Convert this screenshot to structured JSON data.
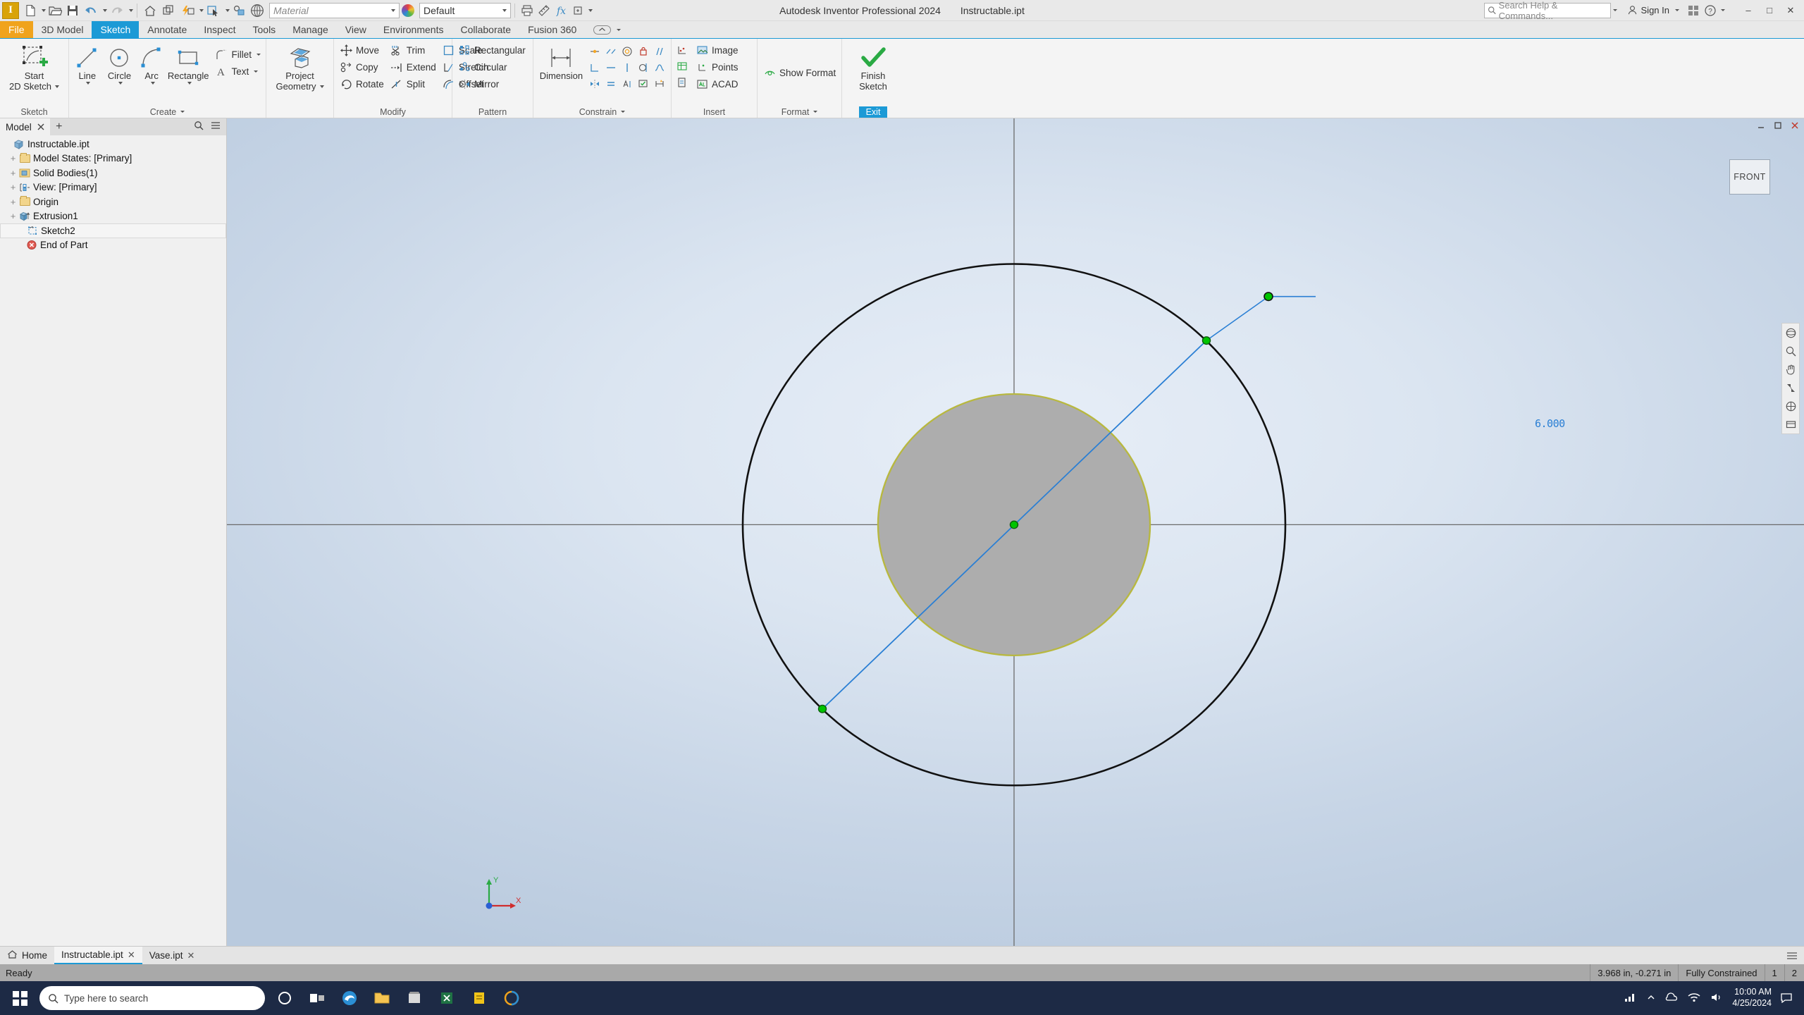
{
  "titlebar": {
    "app_title": "Autodesk Inventor Professional 2024",
    "document_title": "Instructable.ipt",
    "material_value": "Material",
    "appearance_value": "Default",
    "search_placeholder": "Search Help & Commands...",
    "signin_label": "Sign In",
    "minimize": "–",
    "maximize": "□",
    "close": "✕",
    "help_label": "?"
  },
  "ribbon_tabs": {
    "file": "File",
    "items": [
      "3D Model",
      "Sketch",
      "Annotate",
      "Inspect",
      "Tools",
      "Manage",
      "View",
      "Environments",
      "Collaborate",
      "Fusion 360"
    ],
    "active": "Sketch"
  },
  "ribbon": {
    "panels": [
      {
        "title": "Sketch",
        "buttons": [
          {
            "label_line1": "Start",
            "label_line2": "2D Sketch",
            "icon": "start-2d-sketch-icon"
          }
        ]
      },
      {
        "title": "Create",
        "buttons": [
          {
            "label_line1": "Line",
            "icon": "line-icon"
          },
          {
            "label_line1": "Circle",
            "icon": "circle-icon"
          },
          {
            "label_line1": "Arc",
            "icon": "arc-icon"
          },
          {
            "label_line1": "Rectangle",
            "icon": "rectangle-icon"
          }
        ],
        "small_items": [
          {
            "label": "Fillet",
            "icon": "fillet-icon"
          },
          {
            "label": "Text",
            "icon": "text-icon"
          }
        ]
      },
      {
        "title": "",
        "buttons": [
          {
            "label_line1": "Project",
            "label_line2": "Geometry",
            "icon": "project-geometry-icon"
          }
        ]
      },
      {
        "title": "Modify",
        "columns": [
          [
            {
              "label": "Move",
              "icon": "move-icon"
            },
            {
              "label": "Copy",
              "icon": "copy-icon"
            },
            {
              "label": "Rotate",
              "icon": "rotate-icon"
            }
          ],
          [
            {
              "label": "Trim",
              "icon": "trim-icon"
            },
            {
              "label": "Extend",
              "icon": "extend-icon"
            },
            {
              "label": "Split",
              "icon": "split-icon"
            }
          ],
          [
            {
              "label": "Scale",
              "icon": "scale-icon"
            },
            {
              "label": "Stretch",
              "icon": "stretch-icon"
            },
            {
              "label": "Offset",
              "icon": "offset-icon"
            }
          ]
        ]
      },
      {
        "title": "Pattern",
        "columns": [
          [
            {
              "label": "Rectangular",
              "icon": "rectangular-pattern-icon"
            },
            {
              "label": "Circular",
              "icon": "circular-pattern-icon"
            },
            {
              "label": "Mirror",
              "icon": "mirror-icon"
            }
          ]
        ]
      },
      {
        "title": "Constrain",
        "buttons": [
          {
            "label_line1": "Dimension",
            "icon": "dimension-icon"
          }
        ],
        "icon_grid": [
          "coincident-constraint-icon",
          "collinear-constraint-icon",
          "concentric-constraint-icon",
          "fix-constraint-icon",
          "parallel-constraint-icon",
          "perpendicular-constraint-icon",
          "horizontal-constraint-icon",
          "vertical-constraint-icon",
          "tangent-constraint-icon",
          "smooth-constraint-icon",
          "symmetric-constraint-icon",
          "equal-constraint-icon",
          "auto-dimension-icon",
          "show-constraints-icon",
          "relax-mode-icon"
        ]
      },
      {
        "title": "Insert",
        "columns": [
          [
            {
              "label": "Image",
              "icon": "image-icon"
            },
            {
              "label": "Points",
              "icon": "points-icon"
            },
            {
              "label": "ACAD",
              "icon": "acad-icon"
            }
          ]
        ],
        "icon_grid": [
          "import-points-icon",
          "insert-spreadsheet-icon",
          "import-sketch-icon"
        ]
      },
      {
        "title": "Format",
        "columns": [
          [
            {
              "label": "Show Format",
              "icon": "show-format-icon"
            }
          ]
        ]
      },
      {
        "title": "Exit",
        "buttons": [
          {
            "label_line1": "Finish",
            "label_line2": "Sketch",
            "icon": "finish-sketch-checkmark-icon"
          }
        ]
      }
    ]
  },
  "browser": {
    "tab_label": "Model",
    "add_tab": "+",
    "tree": [
      {
        "label": "Instructable.ipt",
        "icon": "part-document-icon",
        "expander": "",
        "depth": 0,
        "selected": false
      },
      {
        "label": "Model States: [Primary]",
        "icon": "folder-icon",
        "expander": "+",
        "depth": 1,
        "selected": false
      },
      {
        "label": "Solid Bodies(1)",
        "icon": "solid-bodies-icon",
        "expander": "+",
        "depth": 1,
        "selected": false
      },
      {
        "label": "View: [Primary]",
        "icon": "view-icon",
        "expander": "+",
        "depth": 1,
        "selected": false
      },
      {
        "label": "Origin",
        "icon": "folder-icon",
        "expander": "+",
        "depth": 1,
        "selected": false
      },
      {
        "label": "Extrusion1",
        "icon": "extrusion-icon",
        "expander": "+",
        "depth": 1,
        "selected": false
      },
      {
        "label": "Sketch2",
        "icon": "sketch-icon",
        "expander": "",
        "depth": 2,
        "selected": true
      },
      {
        "label": "End of Part",
        "icon": "end-of-part-icon",
        "expander": "",
        "depth": 2,
        "selected": false
      }
    ]
  },
  "canvas": {
    "viewcube_label": "FRONT",
    "dimension_value": "6.000",
    "axis_x": "X",
    "axis_y": "Y",
    "colors": {
      "sketch_line": "#2a7fd4",
      "point_green": "#00c400",
      "solid_face": "#adadad",
      "solid_edge": "#b8b840",
      "construction": "#6b6b6b"
    },
    "circle_outer_label": "outer-sketch-circle",
    "circle_inner_label": "extruded-body-circle"
  },
  "doctabs": {
    "home": "Home",
    "tabs": [
      {
        "label": "Instructable.ipt",
        "active": true
      },
      {
        "label": "Vase.ipt",
        "active": false
      }
    ],
    "close_glyph": "✕"
  },
  "statusbar": {
    "message": "Ready",
    "coordinates": "3.968 in, -0.271 in",
    "constraint_state": "Fully Constrained",
    "dof_count": "1",
    "second_count": "2"
  },
  "taskbar": {
    "search_placeholder": "Type here to search",
    "time": "10:00 AM",
    "date": "4/25/2024"
  }
}
